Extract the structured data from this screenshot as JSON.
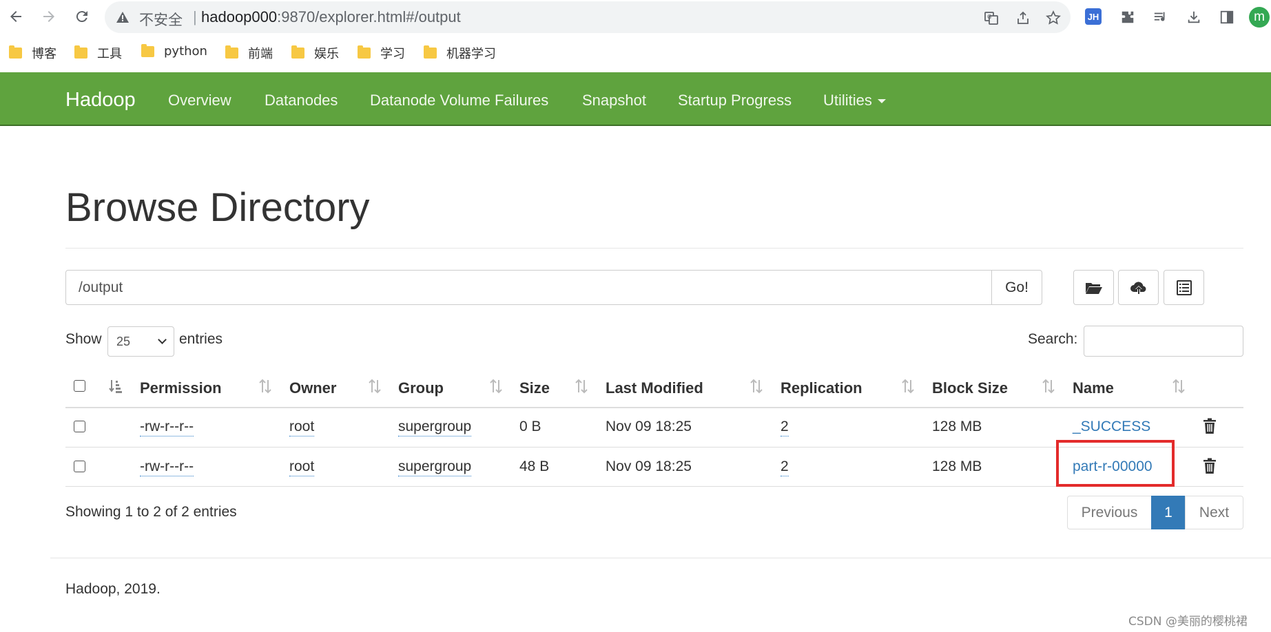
{
  "browser": {
    "security_label": "不安全",
    "separator": "|",
    "url_host": "hadoop000",
    "url_rest": ":9870/explorer.html#/output",
    "profile_initial": "m",
    "extension_label": "JH"
  },
  "bookmarks": [
    "博客",
    "工具",
    "python",
    "前端",
    "娱乐",
    "学习",
    "机器学习"
  ],
  "navbar": {
    "brand": "Hadoop",
    "items": [
      "Overview",
      "Datanodes",
      "Datanode Volume Failures",
      "Snapshot",
      "Startup Progress",
      "Utilities"
    ]
  },
  "page": {
    "title": "Browse Directory",
    "path_value": "/output",
    "go_label": "Go!",
    "show_label": "Show",
    "entries_value": "25",
    "entries_label": "entries",
    "search_label": "Search:"
  },
  "table": {
    "columns": [
      "Permission",
      "Owner",
      "Group",
      "Size",
      "Last Modified",
      "Replication",
      "Block Size",
      "Name"
    ],
    "rows": [
      {
        "permission": "-rw-r--r--",
        "owner": "root",
        "group": "supergroup",
        "size": "0 B",
        "modified": "Nov 09 18:25",
        "replication": "2",
        "block_size": "128 MB",
        "name": "_SUCCESS"
      },
      {
        "permission": "-rw-r--r--",
        "owner": "root",
        "group": "supergroup",
        "size": "48 B",
        "modified": "Nov 09 18:25",
        "replication": "2",
        "block_size": "128 MB",
        "name": "part-r-00000"
      }
    ]
  },
  "pagination": {
    "info": "Showing 1 to 2 of 2 entries",
    "previous": "Previous",
    "current": "1",
    "next": "Next"
  },
  "footer": "Hadoop, 2019.",
  "watermark": "CSDN @美丽的樱桃裙",
  "colors": {
    "navbar": "#5fa33e",
    "link": "#337ab7",
    "highlight": "#e32b2b"
  }
}
